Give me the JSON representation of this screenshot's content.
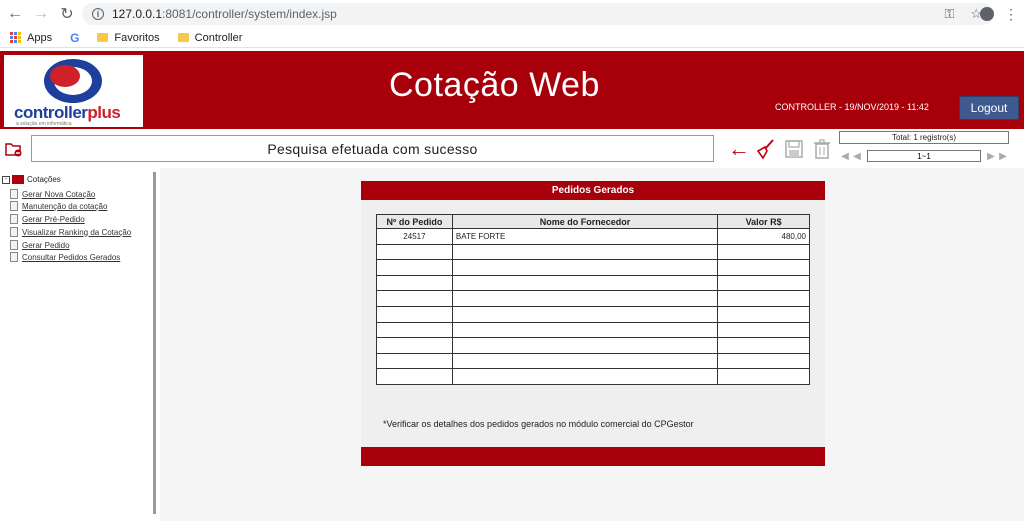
{
  "browser": {
    "url_host": "127.0.0.1",
    "url_path": ":8081/controller/system/index.jsp",
    "bookmarks": [
      {
        "label": "Apps"
      },
      {
        "label": "Favoritos"
      },
      {
        "label": "Controller"
      }
    ]
  },
  "header": {
    "logo_text": "controller",
    "logo_plus": "plus",
    "logo_sub": "a solução em informática",
    "title": "Cotação Web",
    "user_info": "CONTROLLER - 19/NOV/2019 - 11:42",
    "logout_label": "Logout"
  },
  "toolbar": {
    "status_message": "Pesquisa efetuada com sucesso",
    "paging_total": "Total: 1 registro(s)",
    "paging_range": "1~1"
  },
  "sidebar": {
    "root_label": "Cotações",
    "items": [
      {
        "label": "Gerar Nova Cotação"
      },
      {
        "label": "Manutenção da cotação"
      },
      {
        "label": "Gerar Pré-Pedido"
      },
      {
        "label": "Visualizar Ranking da Cotação"
      },
      {
        "label": "Gerar Pedido"
      },
      {
        "label": "Consultar Pedidos Gerados"
      }
    ]
  },
  "panel": {
    "title": "Pedidos Gerados",
    "columns": [
      "Nº do Pedido",
      "Nome do Fornecedor",
      "Valor R$"
    ],
    "rows": [
      {
        "pedido": "24517",
        "fornecedor": "BATE FORTE",
        "valor": "480,00"
      }
    ],
    "note": "*Verificar os detalhes dos pedidos gerados no módulo comercial do CPGestor"
  },
  "colors": {
    "brand_red": "#a8000a",
    "logout_blue": "#3f5a8e"
  },
  "icons": {
    "back": "back-arrow-icon",
    "clear": "broom-icon",
    "save": "save-icon",
    "delete": "trash-icon"
  }
}
